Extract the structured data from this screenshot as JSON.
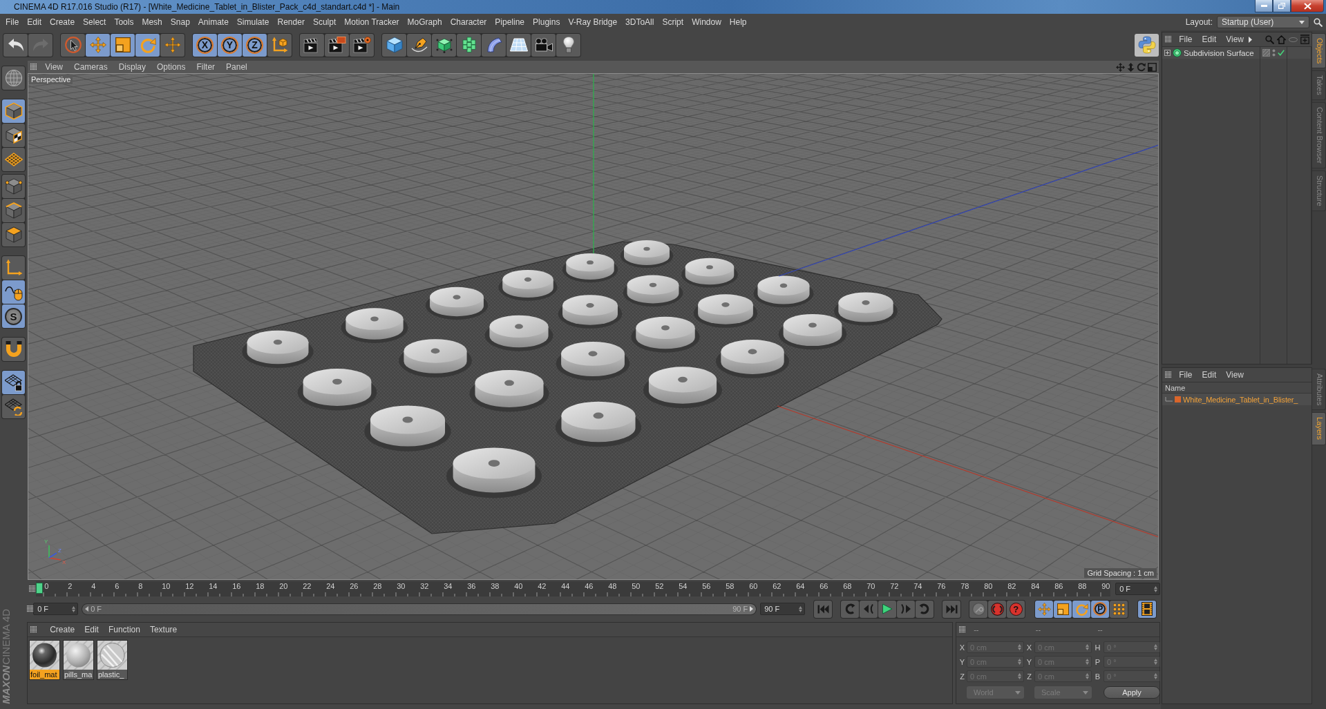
{
  "window": {
    "title": "CINEMA 4D R17.016 Studio (R17) - [White_Medicine_Tablet_in_Blister_Pack_c4d_standart.c4d *] - Main"
  },
  "menu_bar": {
    "items": [
      "File",
      "Edit",
      "Create",
      "Select",
      "Tools",
      "Mesh",
      "Snap",
      "Animate",
      "Simulate",
      "Render",
      "Sculpt",
      "Motion Tracker",
      "MoGraph",
      "Character",
      "Pipeline",
      "Plugins",
      "V-Ray Bridge",
      "3DToAll",
      "Script",
      "Window",
      "Help"
    ],
    "layout_label": "Layout:",
    "layout_value": "Startup (User)"
  },
  "toolbar": {
    "history": [
      {
        "disabled": false
      },
      {
        "disabled": true
      }
    ],
    "tools": [
      {
        "selected": false
      },
      {
        "selected": true
      },
      {
        "selected": true
      },
      {
        "selected": true
      },
      {
        "selected": false
      }
    ],
    "axes": [
      {
        "label": "X",
        "selected": true
      },
      {
        "label": "Y",
        "selected": true
      },
      {
        "label": "Z",
        "selected": true
      }
    ]
  },
  "left_toolbar": {
    "modes": [
      {
        "selected": true
      },
      {
        "selected": false
      },
      {
        "selected": false
      }
    ],
    "components": [
      {
        "selected": false
      },
      {
        "selected": false
      },
      {
        "selected": false
      }
    ],
    "tools": [
      {
        "selected": false
      },
      {
        "selected": true
      },
      {
        "label": "S",
        "selected": true
      }
    ],
    "snapping": [
      {
        "selected": false
      }
    ],
    "workplane": [
      {
        "selected": true
      },
      {
        "selected": false
      }
    ]
  },
  "logo": {
    "brand": "MAXON",
    "product": "CINEMA 4D"
  },
  "viewport": {
    "menu": [
      "View",
      "Cameras",
      "Display",
      "Options",
      "Filter",
      "Panel"
    ],
    "camera": "Perspective",
    "grid_spacing": "Grid Spacing : 1 cm",
    "gizmo": {
      "y": "Y",
      "x": "X",
      "z": "Z"
    }
  },
  "timeline": {
    "ticks": [
      "0",
      "2",
      "4",
      "6",
      "8",
      "10",
      "12",
      "14",
      "16",
      "18",
      "20",
      "22",
      "24",
      "26",
      "28",
      "30",
      "32",
      "34",
      "36",
      "38",
      "40",
      "42",
      "44",
      "46",
      "48",
      "50",
      "52",
      "54",
      "56",
      "58",
      "60",
      "62",
      "64",
      "66",
      "68",
      "70",
      "72",
      "74",
      "76",
      "78",
      "80",
      "82",
      "84",
      "86",
      "88",
      "90"
    ],
    "playhead": {
      "level": 0
    },
    "current_frame": "0 F"
  },
  "playback": {
    "start_frame": "0 F",
    "preview_range": {
      "start": "0 F",
      "end": "90 F",
      "level": 1
    },
    "end_frame": "90 F",
    "keyframe_button": {
      "disabled": true
    },
    "help": "?",
    "key_tracks": [
      {
        "selected": true
      },
      {
        "selected": true
      },
      {
        "selected": true
      },
      {
        "label": "P",
        "selected": true
      },
      {
        "selected": false
      }
    ],
    "timeline_button": {
      "selected": true
    }
  },
  "materials": {
    "menu": [
      "Create",
      "Edit",
      "Function",
      "Texture"
    ],
    "items": [
      {
        "name": "foil_mat",
        "kind": "metallic",
        "selected": true
      },
      {
        "name": "pills_ma",
        "kind": "matte",
        "selected": false
      },
      {
        "name": "plastic_",
        "kind": "transparent",
        "selected": false
      }
    ]
  },
  "coordinates": {
    "disabled": true,
    "headers": [
      "--",
      "--",
      "--"
    ],
    "rows": [
      [
        {
          "axis": "X",
          "value": "0 cm"
        },
        {
          "axis": "X",
          "value": "0 cm"
        },
        {
          "axis": "H",
          "value": "0 °"
        }
      ],
      [
        {
          "axis": "Y",
          "value": "0 cm"
        },
        {
          "axis": "Y",
          "value": "0 cm"
        },
        {
          "axis": "P",
          "value": "0 °"
        }
      ],
      [
        {
          "axis": "Z",
          "value": "0 cm"
        },
        {
          "axis": "Z",
          "value": "0 cm"
        },
        {
          "axis": "B",
          "value": "0 °"
        }
      ]
    ],
    "dropdowns": [
      "World",
      "Scale"
    ],
    "apply": "Apply"
  },
  "objects_manager": {
    "menu": [
      "File",
      "Edit",
      "View"
    ],
    "objects": [
      {
        "name": "Subdivision Surface",
        "expanded": false,
        "enabled": true
      }
    ]
  },
  "upper_tabs": [
    {
      "label": "Objects",
      "selected": true
    },
    {
      "label": "Takes",
      "selected": false
    },
    {
      "label": "Content Browser",
      "selected": false
    },
    {
      "label": "Structure",
      "selected": false
    }
  ],
  "layers_manager": {
    "menu": [
      "File",
      "Edit",
      "View"
    ],
    "column": "Name",
    "layers": [
      {
        "name": "White_Medicine_Tablet_in_Blister_",
        "color": "#d9652b",
        "selected": true
      }
    ]
  },
  "lower_tabs": [
    {
      "label": "Attributes",
      "selected": false
    },
    {
      "label": "Layers",
      "selected": true
    }
  ]
}
